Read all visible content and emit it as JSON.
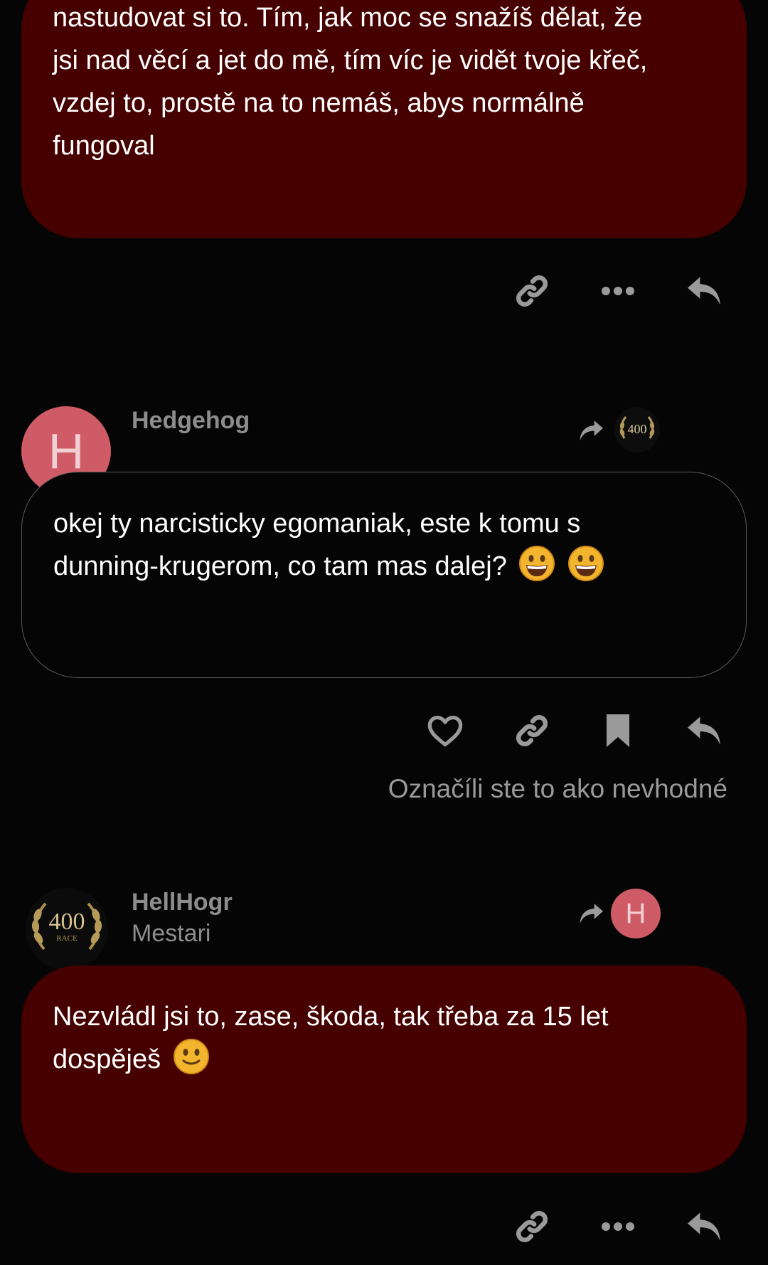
{
  "post1": {
    "lines": [
      "nastudovat si to. Tím, jak moc se snažíš dělat, že",
      "jsi nad věcí a jet do mě, tím víc je vidět tvoje křeč,",
      "vzdej to, prostě na to nemáš, abys normálně",
      "fungoval"
    ],
    "actions": [
      "link-icon",
      "more-icon",
      "reply-icon"
    ]
  },
  "post2": {
    "author": "Hedgehog",
    "avatar_letter": "H",
    "reply_to_avatar": "400 race laurel badge",
    "lines": [
      "okej ty narcisticky egomaniak, este k tomu s",
      "dunning-krugerom, co tam mas dalej?"
    ],
    "emoji": [
      "grinning-face",
      "grinning-face"
    ],
    "actions": [
      "heart-icon",
      "link-icon",
      "bookmark-icon",
      "reply-icon"
    ],
    "flag_note": "Označíli ste to ako nevhodné"
  },
  "post3": {
    "author": "HellHogr",
    "subtitle": "Mestari",
    "badge_text": "400",
    "badge_sub": "RACE",
    "reply_to_letter": "H",
    "lines": [
      "Nezvládl jsi to, zase, škoda, tak třeba za 15 let",
      "dospěješ"
    ],
    "emoji": [
      "slightly-smiling-face"
    ],
    "actions": [
      "link-icon",
      "more-icon",
      "reply-icon"
    ]
  },
  "colors": {
    "background": "#050505",
    "own_bubble": "#470000",
    "avatar_h": "#cf5b66",
    "muted_text": "#8d8d8d",
    "icon": "#9a9a9a"
  }
}
